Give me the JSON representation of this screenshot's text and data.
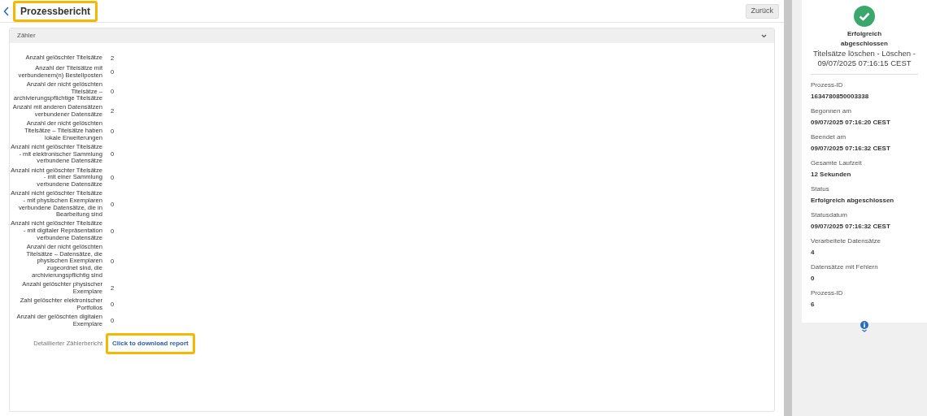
{
  "header": {
    "title": "Prozessbericht",
    "title_highlighted": true,
    "button": "Zurück"
  },
  "counters": {
    "title": "Zähler",
    "expanded": true,
    "rows": [
      {
        "label": "Anzahl gelöschter Titelsätze",
        "value": "2"
      },
      {
        "label": "Anzahl der Titelsätze mit verbundenem(n) Bestellposten",
        "value": "0"
      },
      {
        "label": "Anzahl der nicht gelöschten Titelsätze – archivierungspflichtige Titelsätze",
        "value": "0"
      },
      {
        "label": "Anzahl mit anderen Datensätzen verbundener Datensätze",
        "value": "2"
      },
      {
        "label": "Anzahl der nicht gelöschten Titelsätze – Titelsätze haben lokale Erweiterungen",
        "value": "0"
      },
      {
        "label": "Anzahl nicht gelöschter Titelsätze - mit elektronischer Sammlung verbundene Datensätze",
        "value": "0"
      },
      {
        "label": "Anzahl nicht gelöschter Titelsätze - mit einer Sammlung verbundene Datensätze",
        "value": "0"
      },
      {
        "label": "Anzahl nicht gelöschter Titelsätze - mit physischen Exemplaren verbundene Datensätze, die in Bearbeitung sind",
        "value": "0"
      },
      {
        "label": "Anzahl nicht gelöschter Titelsätze - mit digitaler Repräsentation verbundene Datensätze",
        "value": "0"
      },
      {
        "label": "Anzahl der nicht gelöschten Titelsätze – Datensätze, die physischen Exemplaren zugeordnet sind, die archivierungspflichtig sind",
        "value": "0"
      },
      {
        "label": "Anzahl gelöschter physischer Exemplare",
        "value": "2"
      },
      {
        "label": "Zahl gelöschter elektronischer Portfolios",
        "value": "0"
      },
      {
        "label": "Anzahl der gelöschten digitalen Exemplare",
        "value": "0"
      }
    ],
    "report": {
      "label": "Detaillierter Zählerbericht",
      "link": "Click to download report",
      "link_highlighted": true
    }
  },
  "summary": {
    "status_title": "Erfolgreich abgeschlossen",
    "job": "Titelsätze löschen - Löschen - 09/07/2025 07:16:15 CEST",
    "fields": [
      {
        "label": "Prozess-ID",
        "value": "1634780850003338"
      },
      {
        "label": "Begonnen am",
        "value": "09/07/2025 07:16:20 CEST"
      },
      {
        "label": "Beendet am",
        "value": "09/07/2025 07:16:32 CEST"
      },
      {
        "label": "Gesamte Laufzeit",
        "value": "12 Sekunden"
      },
      {
        "label": "Status",
        "value": "Erfolgreich abgeschlossen"
      },
      {
        "label": "Statusdatum",
        "value": "09/07/2025 07:16:32 CEST"
      },
      {
        "label": "Verarbeitete Datensätze",
        "value": "4"
      },
      {
        "label": "Datensätze mit Fehlern",
        "value": "0"
      },
      {
        "label": "Prozess-ID",
        "value": "6"
      }
    ]
  }
}
